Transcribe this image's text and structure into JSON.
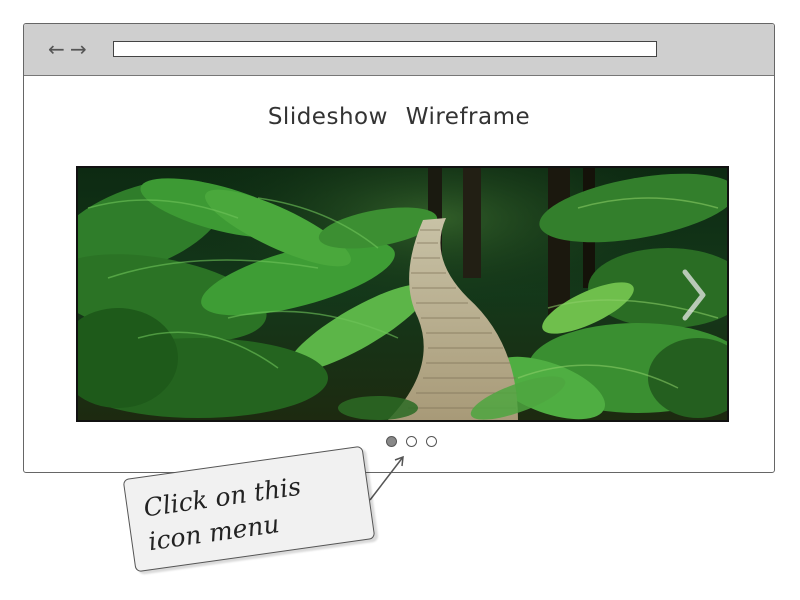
{
  "browser": {
    "back_icon": "arrow-left-icon",
    "forward_icon": "arrow-right-icon",
    "address_value": ""
  },
  "page": {
    "title": "Slideshow Wireframe"
  },
  "slideshow": {
    "image_subject": "forest boardwalk with ferns",
    "next_icon": "chevron-right-icon",
    "slide_count": 3,
    "active_index": 0
  },
  "annotation": {
    "text": "Click on this\nicon menu"
  }
}
